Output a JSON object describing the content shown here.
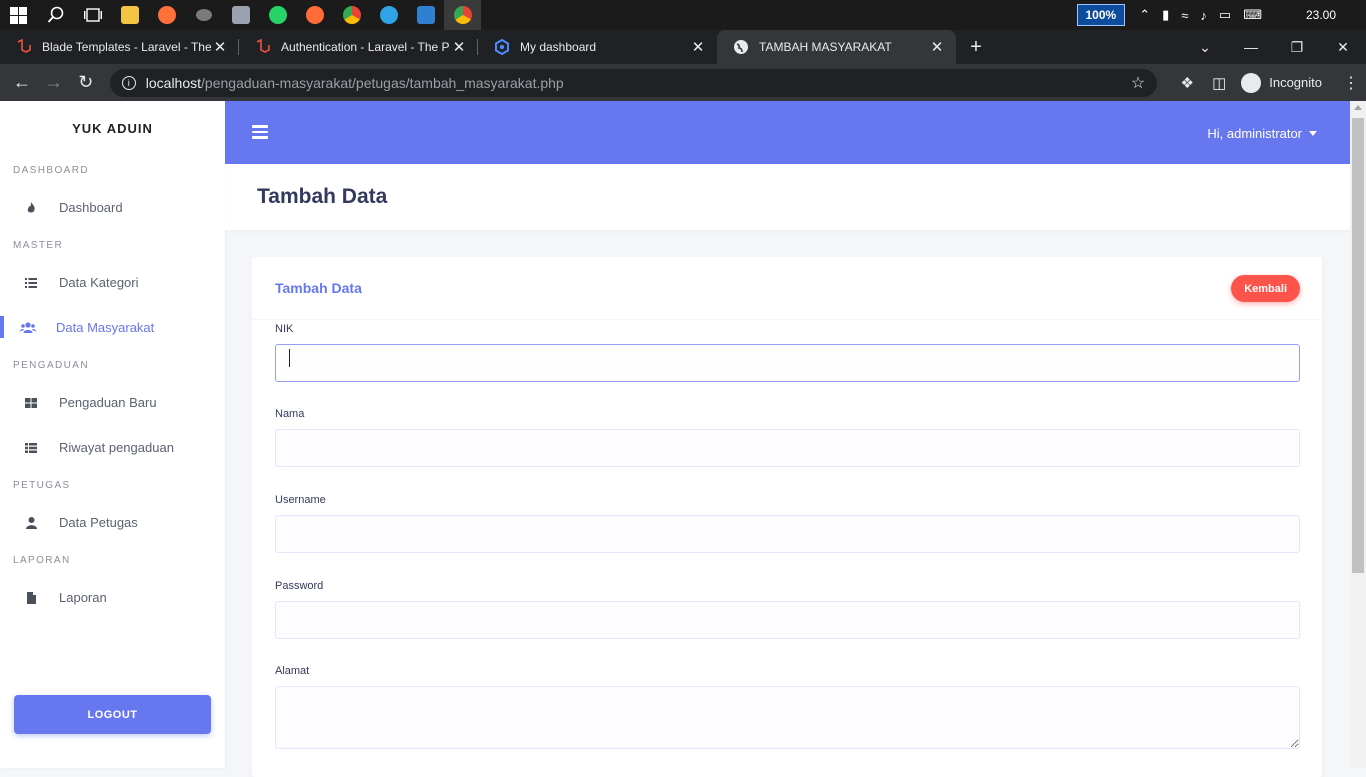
{
  "taskbar": {
    "zoom": "100%",
    "clock": "23.00"
  },
  "browser": {
    "tabs": [
      {
        "title": "Blade Templates - Laravel - The PHP Framework",
        "favicon": "laravel-icon",
        "active": false
      },
      {
        "title": "Authentication - Laravel - The PHP Framework",
        "favicon": "laravel-icon",
        "active": false
      },
      {
        "title": "My dashboard",
        "favicon": "dashboard-icon",
        "active": false
      },
      {
        "title": "TAMBAH MASYARAKAT",
        "favicon": "globe-icon",
        "active": true
      }
    ],
    "url_host": "localhost",
    "url_path": "/pengaduan-masyarakat/petugas/tambah_masyarakat.php",
    "incognito_label": "Incognito"
  },
  "sidebar": {
    "brand": "YUK ADUIN",
    "sections": [
      {
        "heading": "DASHBOARD",
        "items": [
          {
            "label": "Dashboard",
            "icon": "fire-icon",
            "active": false
          }
        ]
      },
      {
        "heading": "MASTER",
        "items": [
          {
            "label": "Data Kategori",
            "icon": "list-icon",
            "active": false
          },
          {
            "label": "Data Masyarakat",
            "icon": "users-icon",
            "active": true
          }
        ]
      },
      {
        "heading": "PENGADUAN",
        "items": [
          {
            "label": "Pengaduan Baru",
            "icon": "grid-icon",
            "active": false
          },
          {
            "label": "Riwayat pengaduan",
            "icon": "table-icon",
            "active": false
          }
        ]
      },
      {
        "heading": "PETUGAS",
        "items": [
          {
            "label": "Data Petugas",
            "icon": "user-icon",
            "active": false
          }
        ]
      },
      {
        "heading": "LAPORAN",
        "items": [
          {
            "label": "Laporan",
            "icon": "file-icon",
            "active": false
          }
        ]
      }
    ],
    "logout_label": "LOGOUT"
  },
  "navbar": {
    "user_greeting": "Hi, administrator"
  },
  "page": {
    "title": "Tambah Data"
  },
  "card": {
    "title": "Tambah Data",
    "back_label": "Kembali",
    "fields": [
      {
        "label": "NIK",
        "value": ""
      },
      {
        "label": "Nama",
        "value": ""
      },
      {
        "label": "Username",
        "value": ""
      },
      {
        "label": "Password",
        "value": ""
      },
      {
        "label": "Alamat",
        "value": ""
      }
    ]
  },
  "colors": {
    "primary": "#6777ef",
    "danger": "#fc544b",
    "heading": "#34395e"
  }
}
